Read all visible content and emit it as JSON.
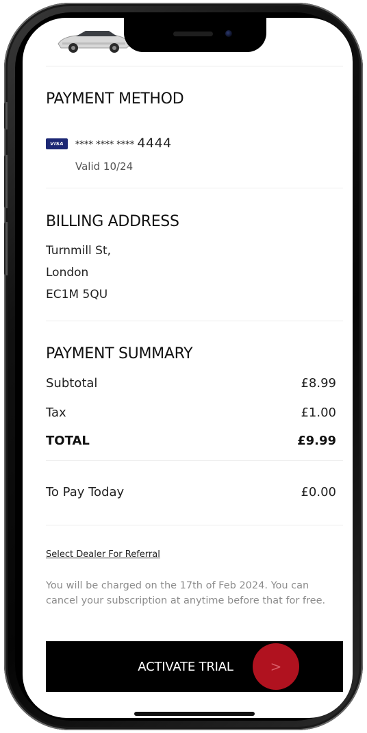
{
  "payment_method": {
    "title": "PAYMENT METHOD",
    "card_brand": "VISA",
    "card_masked": "**** **** ****",
    "card_last4": "4444",
    "valid": "Valid 10/24"
  },
  "billing_address": {
    "title": "BILLING ADDRESS",
    "lines": [
      "Turnmill St,",
      "London",
      "EC1M 5QU"
    ]
  },
  "payment_summary": {
    "title": "PAYMENT SUMMARY",
    "subtotal_label": "Subtotal",
    "subtotal_value": "£8.99",
    "tax_label": "Tax",
    "tax_value": "£1.00",
    "total_label": "TOTAL",
    "total_value": "£9.99",
    "today_label": "To Pay Today",
    "today_value": "£0.00"
  },
  "dealer_link": "Select Dealer For Referral",
  "notice": "You will be charged on the 17th of Feb 2024. You can cancel your subscription at anytime before that for free.",
  "cta": {
    "label": "ACTIVATE TRIAL",
    "arrow": ">"
  },
  "colors": {
    "accent": "#b0121f",
    "button_bg": "#000000",
    "visa_blue": "#1c2774"
  }
}
